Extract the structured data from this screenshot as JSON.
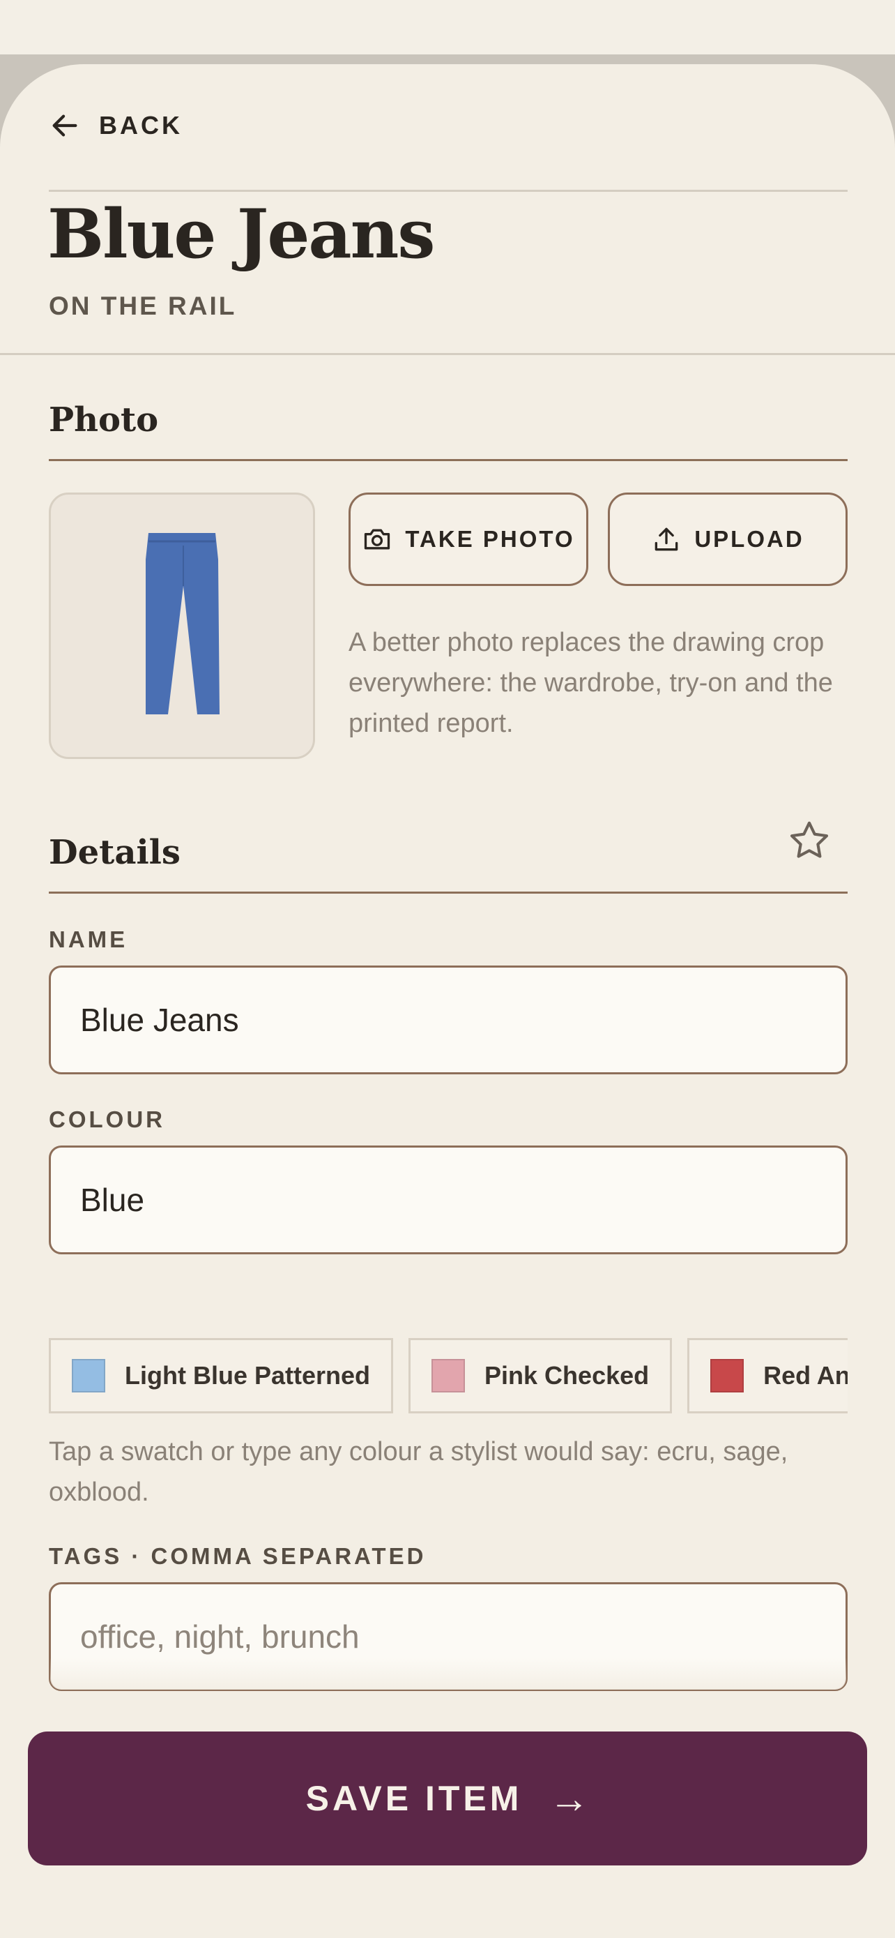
{
  "nav": {
    "back_label": "BACK"
  },
  "item": {
    "title": "Blue Jeans",
    "status": "ON THE RAIL"
  },
  "photo": {
    "heading": "Photo",
    "take_photo_label": "TAKE PHOTO",
    "upload_label": "UPLOAD",
    "help": "A better photo replaces the drawing crop everywhere: the wardrobe, try-on and the printed report.",
    "garment_color": "#4a6fb3"
  },
  "details": {
    "heading": "Details",
    "favorite_icon": "star-outline-icon",
    "name": {
      "label": "NAME",
      "value": "Blue Jeans"
    },
    "colour": {
      "label": "COLOUR",
      "value": "Blue"
    },
    "swatches": [
      {
        "label": "Light Blue Patterned",
        "color": "#94bde3"
      },
      {
        "label": "Pink Checked",
        "color": "#e2a5ad"
      },
      {
        "label": "Red And Navy",
        "color": "#c8484a"
      }
    ],
    "colour_help": "Tap a swatch or type any colour a stylist would say: ecru, sage, oxblood.",
    "tags": {
      "label": "TAGS · COMMA SEPARATED",
      "value": "",
      "placeholder": "office, night, brunch"
    }
  },
  "actions": {
    "save_label": "SAVE ITEM",
    "save_arrow": "→"
  },
  "colors": {
    "accent": "#5c2748",
    "border": "#8d6e59",
    "background": "#f3eee4"
  }
}
